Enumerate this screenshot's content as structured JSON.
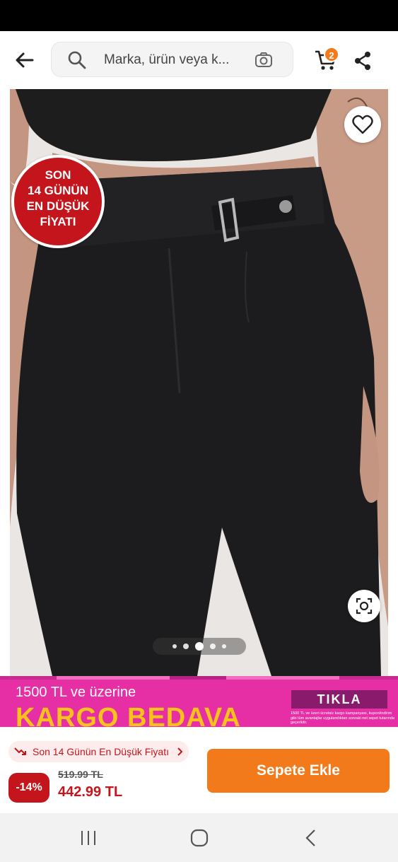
{
  "search": {
    "placeholder": "Marka, ürün veya k..."
  },
  "cart": {
    "count": "2"
  },
  "product": {
    "promo_seal_lines": [
      "SON",
      "14 GÜNÜN",
      "EN DÜŞÜK",
      "FİYATI"
    ],
    "gallery_total_dots": 5,
    "gallery_active_index": 2
  },
  "banner": {
    "line1": "1500 TL ve üzerine",
    "line2": "KARGO BEDAVA",
    "cta": "TIKLA",
    "fine_print": "1500 TL ve üzeri ücretsiz kargo kampanyası, kupon/indirim gibi tüm avantajlar uygulandıktan sonraki net sepet tutarında geçerlidir."
  },
  "price": {
    "lowest_label": "Son 14 Günün En Düşük Fiyatı",
    "discount": "-14%",
    "old_price": "519.99 TL",
    "current_price": "442.99 TL"
  },
  "actions": {
    "add_to_cart": "Sepete Ekle"
  },
  "colors": {
    "accent": "#f27a1a",
    "discount_red": "#c4151c",
    "banner_pink": "#e62fa4",
    "banner_yellow": "#f7c21b"
  },
  "icons": [
    "back-arrow-icon",
    "search-icon",
    "camera-search-icon",
    "cart-icon",
    "share-icon",
    "heart-icon",
    "lens-icon",
    "trend-down-icon",
    "chevron-right-icon",
    "recents-icon",
    "home-icon",
    "back-icon"
  ]
}
